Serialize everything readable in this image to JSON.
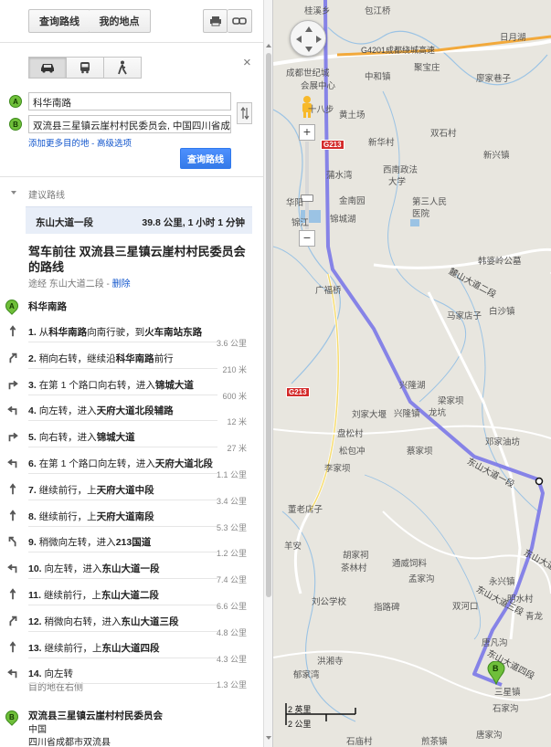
{
  "toolbar": {
    "directions_label": "查询路线",
    "my_places_label": "我的地点"
  },
  "travel_modes": [
    "driving",
    "transit",
    "walking"
  ],
  "form": {
    "origin_marker": "A",
    "origin_value": "科华南路",
    "destination_marker": "B",
    "destination_value": "双流县三星镇云崖村村民委员会, 中国四川省成都",
    "add_destination_link": "添加更多目的地",
    "separator": " - ",
    "advanced_link": "高级选项",
    "submit_label": "查询路线"
  },
  "suggested": {
    "header": "建议路线",
    "route_name": "东山大道一段",
    "route_summary": "39.8 公里, 1 小时 1 分钟"
  },
  "directions": {
    "title": "驾车前往 双流县三星镇云崖村村民委员会 的路线",
    "via_label": "途经 东山大道二段 - ",
    "delete_link": "删除",
    "start_marker": "A",
    "start_name": "科华南路",
    "steps": [
      {
        "num": "1.",
        "pre": "从",
        "bold1": "科华南路",
        "mid": "向南行驶，到",
        "bold2": "火车南站东路",
        "dist": "3.6 公里",
        "icon": "straight"
      },
      {
        "num": "2.",
        "pre": "稍向右转，继续沿",
        "bold1": "科华南路",
        "mid": "前行",
        "bold2": "",
        "dist": "210 米",
        "icon": "slight-right"
      },
      {
        "num": "3.",
        "pre": "在第 1 个路口向右转，进入",
        "bold1": "锦城大道",
        "mid": "",
        "bold2": "",
        "dist": "600 米",
        "icon": "right"
      },
      {
        "num": "4.",
        "pre": "向左转，进入",
        "bold1": "天府大道北段辅路",
        "mid": "",
        "bold2": "",
        "dist": "12 米",
        "icon": "left"
      },
      {
        "num": "5.",
        "pre": "向右转，进入",
        "bold1": "锦城大道",
        "mid": "",
        "bold2": "",
        "dist": "27 米",
        "icon": "right"
      },
      {
        "num": "6.",
        "pre": "在第 1 个路口向左转，进入",
        "bold1": "天府大道北段",
        "mid": "",
        "bold2": "",
        "dist": "1.1 公里",
        "icon": "left"
      },
      {
        "num": "7.",
        "pre": "继续前行，上",
        "bold1": "天府大道中段",
        "mid": "",
        "bold2": "",
        "dist": "3.4 公里",
        "icon": "straight"
      },
      {
        "num": "8.",
        "pre": "继续前行，上",
        "bold1": "天府大道南段",
        "mid": "",
        "bold2": "",
        "dist": "5.3 公里",
        "icon": "straight"
      },
      {
        "num": "9.",
        "pre": "稍微向左转，进入",
        "bold1": "213国道",
        "mid": "",
        "bold2": "",
        "dist": "1.2 公里",
        "icon": "slight-left"
      },
      {
        "num": "10.",
        "pre": "向左转，进入",
        "bold1": "东山大道一段",
        "mid": "",
        "bold2": "",
        "dist": "7.4 公里",
        "icon": "left"
      },
      {
        "num": "11.",
        "pre": "继续前行，上",
        "bold1": "东山大道二段",
        "mid": "",
        "bold2": "",
        "dist": "6.6 公里",
        "icon": "straight"
      },
      {
        "num": "12.",
        "pre": "稍微向右转，进入",
        "bold1": "东山大道三段",
        "mid": "",
        "bold2": "",
        "dist": "4.8 公里",
        "icon": "slight-right"
      },
      {
        "num": "13.",
        "pre": "继续前行，上",
        "bold1": "东山大道四段",
        "mid": "",
        "bold2": "",
        "dist": "4.3 公里",
        "icon": "straight"
      },
      {
        "num": "14.",
        "pre": "向左转",
        "bold1": "",
        "mid": "",
        "bold2": "",
        "dist": "1.3 公里",
        "icon": "left",
        "sub": "目的地在右侧"
      }
    ],
    "end_marker": "B",
    "end_name": "双流县三星镇云崖村村民委员会",
    "end_country": "中国",
    "end_region": "四川省成都市双流县"
  },
  "map": {
    "scale_km": "2 公里",
    "scale_mi": "2 英里",
    "marker_b": "B",
    "colors": {
      "route": "#7b78e8",
      "highway": "#f2a93b",
      "shield": "#d42b2b"
    },
    "labels": [
      "桂溪乡",
      "包江桥",
      "日月湖",
      "G4201成都绕城高速",
      "成都世纪城",
      "会展中心",
      "中和镇",
      "聚宝庄",
      "廖家巷子",
      "十八步",
      "黄土场",
      "双石村",
      "新华村",
      "新兴镇",
      "G213",
      "华阳",
      "锦江",
      "西南政法",
      "大学",
      "第三人民",
      "医院",
      "金南园",
      "锦城湖",
      "蒲水湾",
      "麓山大道二段",
      "韩婆岭公墓",
      "白沙镇",
      "马家店子",
      "广福桥",
      "兴隆湖",
      "龙坑",
      "刘家大堰",
      "兴隆镇",
      "梁家坝",
      "盘松村",
      "邓家油坊",
      "松包冲",
      "蔡家坝",
      "李家坝",
      "东山大道一段",
      "东山大道二段",
      "东山大道三段",
      "东山大道四段",
      "胡家祠",
      "通威饲料",
      "孟家沟",
      "茶林村",
      "永兴镇",
      "刘公学校",
      "指路碑",
      "双河口",
      "明水村",
      "青龙",
      "洪湘寺",
      "唐凡沟",
      "郁家湾",
      "石家沟",
      "三星镇",
      "唐家沟",
      "石庙村",
      "煎茶镇",
      "董老店子",
      "羊安",
      "G213"
    ]
  }
}
